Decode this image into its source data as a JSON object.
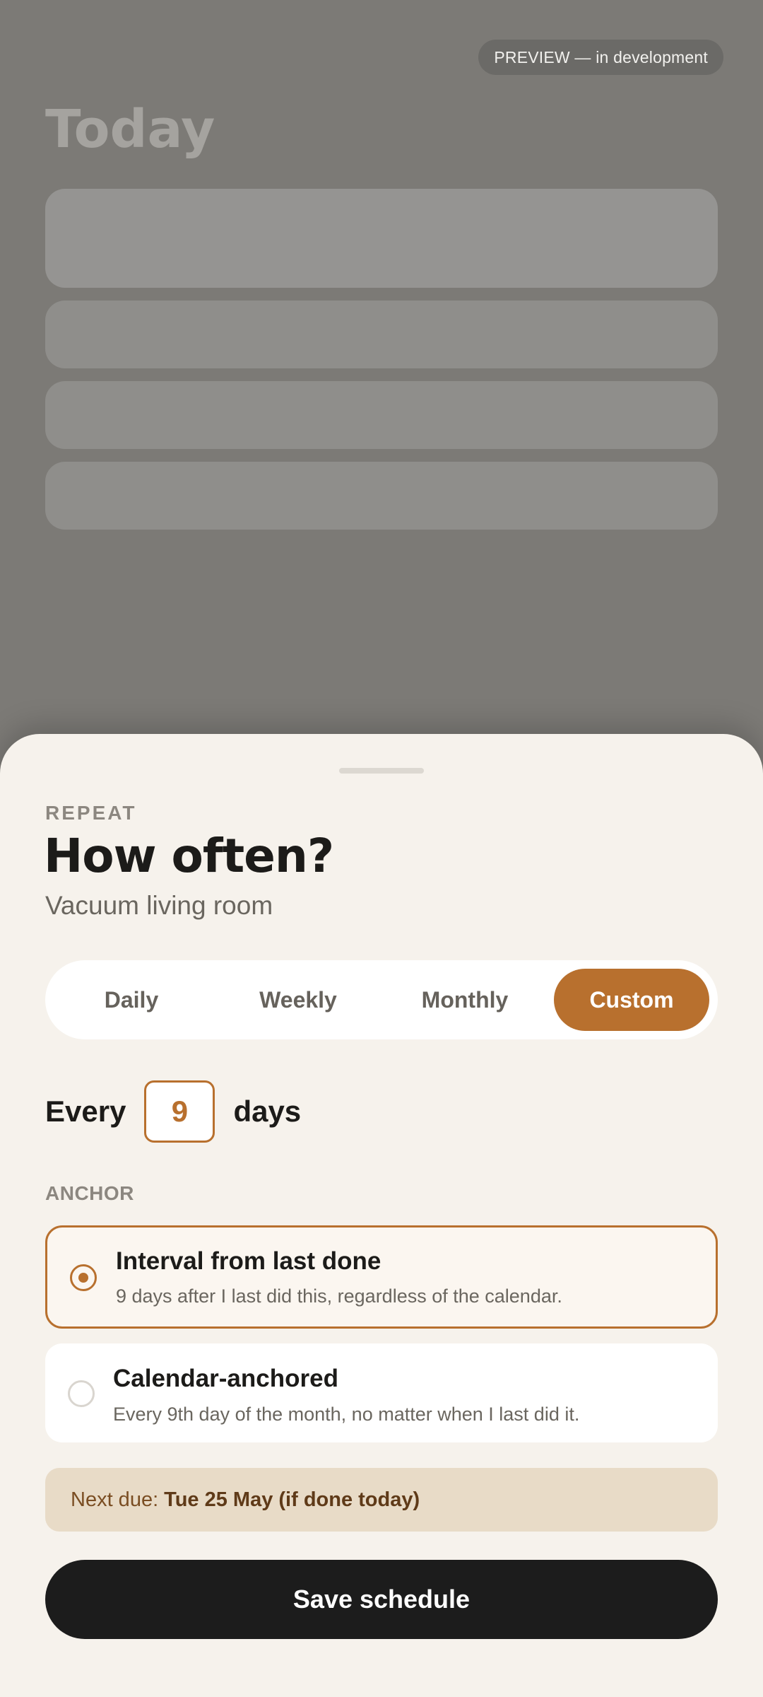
{
  "background": {
    "preview_badge": "PREVIEW — in development",
    "title": "Today"
  },
  "sheet": {
    "eyebrow": "REPEAT",
    "title": "How often?",
    "subtitle": "Vacuum living room",
    "segments": [
      {
        "label": "Daily",
        "selected": false
      },
      {
        "label": "Weekly",
        "selected": false
      },
      {
        "label": "Monthly",
        "selected": false
      },
      {
        "label": "Custom",
        "selected": true
      }
    ],
    "interval": {
      "prefix": "Every",
      "value": "9",
      "unit": "days"
    },
    "anchor": {
      "label": "ANCHOR",
      "options": [
        {
          "title": "Interval from last done",
          "description": "9 days after I last did this, regardless of the calendar.",
          "selected": true
        },
        {
          "title": "Calendar-anchored",
          "description": "Every 9th day of the month, no matter when I last did it.",
          "selected": false
        }
      ]
    },
    "next_due": {
      "label": "Next due:",
      "value": "Tue 25 May (if done today)"
    },
    "save_label": "Save schedule"
  },
  "colors": {
    "accent": "#b8702e",
    "sheet_bg": "#f6f2ec",
    "primary_button": "#1c1c1c",
    "next_due_bg": "#e8dbc7"
  }
}
